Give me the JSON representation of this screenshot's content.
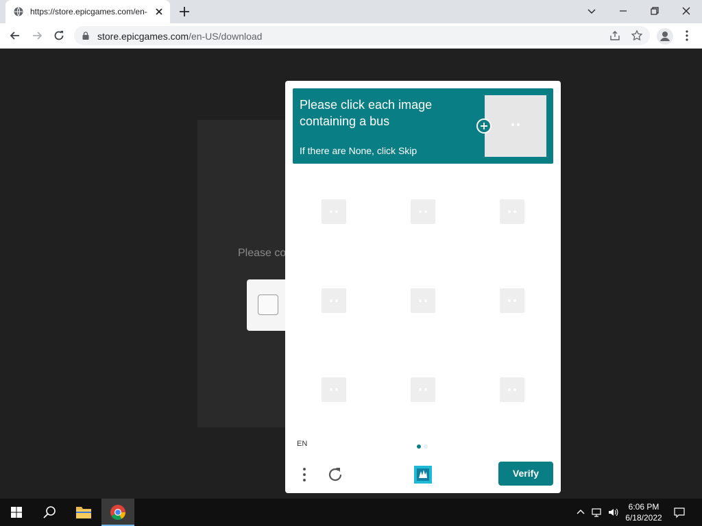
{
  "browser": {
    "tab_title": "https://store.epicgames.com/en-",
    "url_host": "store.epicgames.com",
    "url_path": "/en-US/download"
  },
  "page": {
    "behind_text": "Please co"
  },
  "captcha": {
    "prompt_line": "Please click each image containing a bus",
    "prompt_sub": "If there are None, click Skip",
    "language": "EN",
    "verify_label": "Verify",
    "accent_color": "#0a7e85",
    "grid_rows": 3,
    "grid_cols": 3
  },
  "taskbar": {
    "time": "6:06 PM",
    "date": "6/18/2022"
  },
  "icons": {
    "tab_favicon": "globe-icon",
    "tab_close": "close-icon",
    "new_tab": "plus-icon",
    "back": "arrow-left-icon",
    "forward": "arrow-right-icon",
    "reload": "reload-icon",
    "lock": "lock-icon",
    "share": "share-icon",
    "bookmark": "star-icon",
    "profile": "person-icon",
    "menu": "kebab-icon",
    "start": "windows-icon",
    "search": "search-icon",
    "files": "folder-icon",
    "chrome": "chrome-icon",
    "tray_up": "chevron-up-icon",
    "network": "network-icon",
    "volume": "volume-icon",
    "notifications": "notification-icon"
  }
}
